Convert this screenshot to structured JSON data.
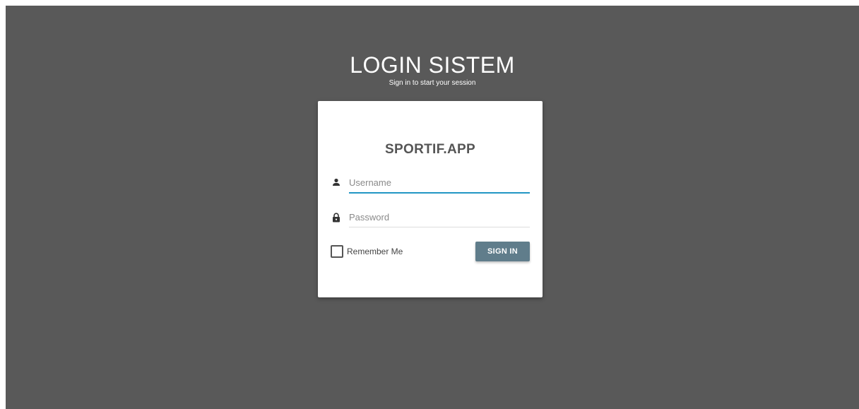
{
  "header": {
    "title": "LOGIN SISTEM",
    "subtitle": "Sign in to start your session"
  },
  "card": {
    "brand": "SPORTIF.APP",
    "username": {
      "icon": "person-icon",
      "value": "",
      "placeholder": "Username"
    },
    "password": {
      "icon": "lock-icon",
      "value": "",
      "placeholder": "Password"
    },
    "remember": {
      "label": "Remember Me",
      "checked": false
    },
    "signin_label": "SIGN IN"
  },
  "colors": {
    "background": "#595959",
    "card": "#ffffff",
    "button": "#607d8b",
    "focus_underline": "#2196c4",
    "brand_text": "#555555"
  }
}
